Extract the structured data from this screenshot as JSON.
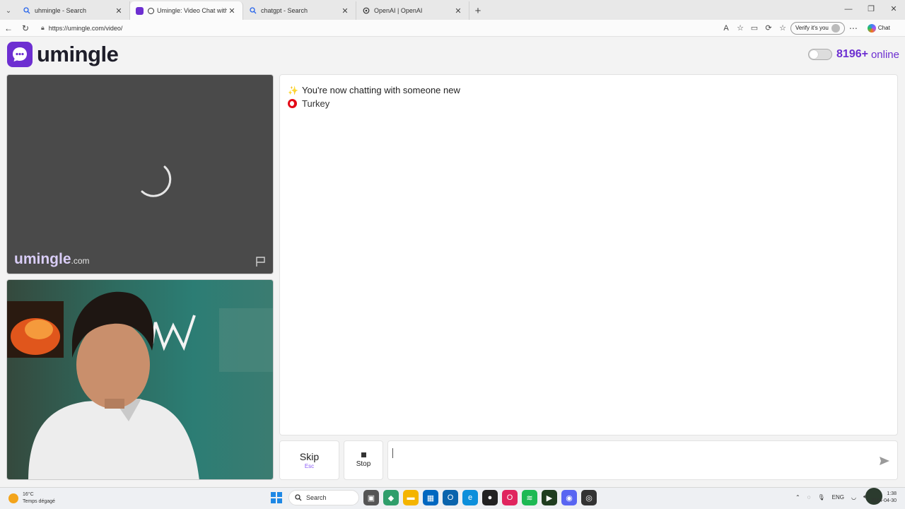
{
  "browser": {
    "tabs": [
      {
        "title": "uhmingle - Search",
        "favicon": "search-icon",
        "active": false
      },
      {
        "title": "Umingle: Video Chat with Stra",
        "favicon": "umingle-icon",
        "active": true
      },
      {
        "title": "chatgpt - Search",
        "favicon": "search-icon",
        "active": false
      },
      {
        "title": "OpenAI | OpenAI",
        "favicon": "openai-icon",
        "active": false
      }
    ],
    "url": "https://umingle.com/video/",
    "verify_label": "Verify it's you",
    "chat_label": "Chat"
  },
  "header": {
    "brand": "umingle",
    "online_count": "8196+",
    "online_label": "online"
  },
  "stranger": {
    "watermark": "umingle",
    "watermark_suffix": ".com"
  },
  "chat": {
    "status_message": "You're now chatting with someone new",
    "status_icon": "sparkles-icon",
    "country": "Turkey",
    "country_flag_color": "#e30a17"
  },
  "controls": {
    "skip_label": "Skip",
    "skip_shortcut": "Esc",
    "stop_label": "Stop",
    "message_value": ""
  },
  "taskbar": {
    "temperature": "16°C",
    "weather_text": "Temps dégagé",
    "search_label": "Search",
    "language": "ENG",
    "time": "1:38",
    "date": "2024-04-30"
  },
  "colors": {
    "brand": "#6d2fd1",
    "accent_text": "#8b5cf6"
  }
}
